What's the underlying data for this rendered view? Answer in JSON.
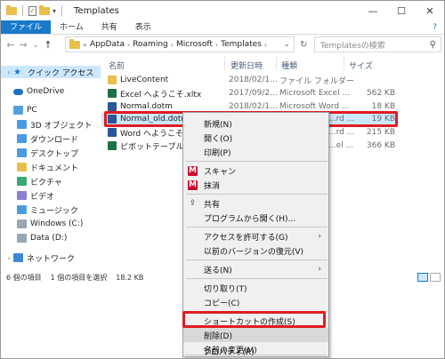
{
  "window": {
    "title": "Templates",
    "controls": {
      "minimize": "—",
      "maximize": "☐",
      "close": "✕"
    }
  },
  "ribbon": {
    "tabs": [
      "ファイル",
      "ホーム",
      "共有",
      "表示"
    ],
    "help": "?"
  },
  "address": {
    "prefix": "«",
    "crumbs": [
      "AppData",
      "Roaming",
      "Microsoft",
      "Templates"
    ],
    "separator": "›",
    "search_placeholder": "Templatesの検索"
  },
  "navpane": {
    "quick_access": "クイック アクセス",
    "onedrive": "OneDrive",
    "pc": "PC",
    "items": [
      "3D オブジェクト",
      "ダウンロード",
      "デスクトップ",
      "ドキュメント",
      "ピクチャ",
      "ビデオ",
      "ミュージック",
      "Windows (C:)",
      "Data (D:)"
    ],
    "network": "ネットワーク"
  },
  "filelist": {
    "headers": {
      "name": "名前",
      "date": "更新日時",
      "type": "種類",
      "size": "サイズ"
    },
    "rows": [
      {
        "name": "LiveContent",
        "date": "2018/02/1...",
        "type": "ファイル フォルダー",
        "size": "",
        "icon": "folder-icon"
      },
      {
        "name": "Excel へようこそ.xltx",
        "date": "2017/09/2...",
        "type": "Microsoft Excel ...",
        "size": "562 KB",
        "icon": "excel-file-icon"
      },
      {
        "name": "Normal.dotm",
        "date": "2018/02/1...",
        "type": "Microsoft Word ...",
        "size": "18 KB",
        "icon": "word-file-icon"
      },
      {
        "name": "Normal_old.dotm",
        "date": "",
        "type": "...rd ...",
        "size": "19 KB",
        "icon": "word-file-icon"
      },
      {
        "name": "Word へようこそ.dotx",
        "date": "",
        "type": "...rd ...",
        "size": "215 KB",
        "icon": "word-file-icon"
      },
      {
        "name": "ピボットテーブル入門.x",
        "date": "",
        "type": "...el ...",
        "size": "366 KB",
        "icon": "excel-file-icon"
      }
    ]
  },
  "statusbar": {
    "count": "6 個の項目",
    "selection": "1 個の項目を選択",
    "size": "18.2 KB"
  },
  "context_menu": {
    "items": [
      "新規(N)",
      "開く(O)",
      "印刷(P)",
      "スキャン",
      "抹消",
      "共有",
      "プログラムから開く(H)...",
      "アクセスを許可する(G)",
      "以前のバージョンの復元(V)",
      "送る(N)",
      "切り取り(T)",
      "コピー(C)",
      "ショートカットの作成(S)",
      "削除(D)",
      "名前の変更(M)",
      "プロパティ(R)"
    ],
    "submenu_arrow": "›"
  },
  "colors": {
    "accent": "#1979ca",
    "highlight": "#e11b22",
    "selection": "#cce8ff"
  }
}
